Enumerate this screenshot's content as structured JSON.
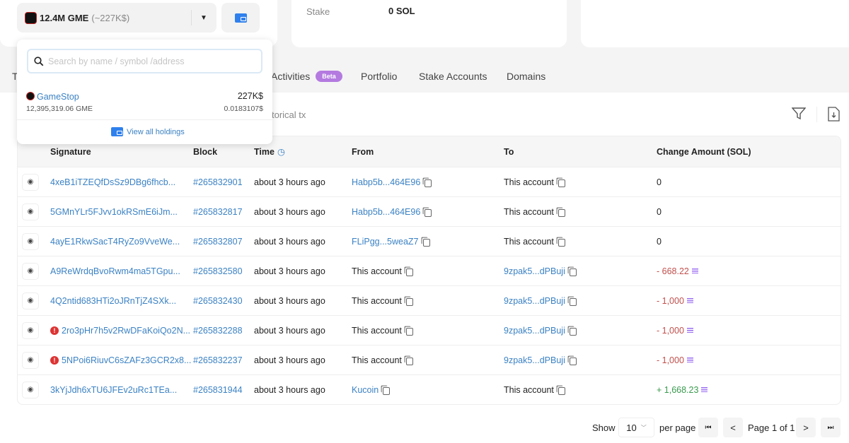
{
  "token_selector": {
    "amount": "12.4M GME",
    "value": "(~227K$)"
  },
  "stake": {
    "label": "Stake",
    "value": "0 SOL"
  },
  "tabs": [
    {
      "label": "T"
    },
    {
      "label": "Activities",
      "badge": "Beta"
    },
    {
      "label": "Portfolio"
    },
    {
      "label": "Stake Accounts"
    },
    {
      "label": "Domains"
    }
  ],
  "historical_text": "torical tx",
  "dropdown": {
    "search_placeholder": "Search by name / symbol /address",
    "holding": {
      "name": "GameStop",
      "amount": "12,395,319.06 GME",
      "value": "227K$",
      "price": "0.0183107$"
    },
    "view_all": "View all holdings"
  },
  "table": {
    "headers": [
      "Signature",
      "Block",
      "Time",
      "From",
      "To",
      "Change Amount (SOL)"
    ],
    "rows": [
      {
        "sig": "4xeB1iTZEQfDsSz9DBg6fhcb...",
        "err": false,
        "block": "#265832901",
        "time": "about 3 hours ago",
        "from": "Habp5b...464E96",
        "from_link": true,
        "to": "This account",
        "to_link": false,
        "change": "0",
        "dir": "zero"
      },
      {
        "sig": "5GMnYLr5FJvv1okRSmE6iJm...",
        "err": false,
        "block": "#265832817",
        "time": "about 3 hours ago",
        "from": "Habp5b...464E96",
        "from_link": true,
        "to": "This account",
        "to_link": false,
        "change": "0",
        "dir": "zero"
      },
      {
        "sig": "4ayE1RkwSacT4RyZo9VveWe...",
        "err": false,
        "block": "#265832807",
        "time": "about 3 hours ago",
        "from": "FLiPgg...5weaZ7",
        "from_link": true,
        "to": "This account",
        "to_link": false,
        "change": "0",
        "dir": "zero"
      },
      {
        "sig": "A9ReWrdqBvoRwm4ma5TGpu...",
        "err": false,
        "block": "#265832580",
        "time": "about 3 hours ago",
        "from": "This account",
        "from_link": false,
        "to": "9zpak5...dPBuji",
        "to_link": true,
        "change": "- 668.22",
        "dir": "neg"
      },
      {
        "sig": "4Q2ntid683HTi2oJRnTjZ4SXk...",
        "err": false,
        "block": "#265832430",
        "time": "about 3 hours ago",
        "from": "This account",
        "from_link": false,
        "to": "9zpak5...dPBuji",
        "to_link": true,
        "change": "- 1,000",
        "dir": "neg"
      },
      {
        "sig": "2ro3pHr7h5v2RwDFaKoiQo2N...",
        "err": true,
        "block": "#265832288",
        "time": "about 3 hours ago",
        "from": "This account",
        "from_link": false,
        "to": "9zpak5...dPBuji",
        "to_link": true,
        "change": "- 1,000",
        "dir": "neg"
      },
      {
        "sig": "5NPoi6RiuvC6sZAFz3GCR2x8...",
        "err": true,
        "block": "#265832237",
        "time": "about 3 hours ago",
        "from": "This account",
        "from_link": false,
        "to": "9zpak5...dPBuji",
        "to_link": true,
        "change": "- 1,000",
        "dir": "neg"
      },
      {
        "sig": "3kYjJdh6xTU6JFEv2uRc1TEa...",
        "err": false,
        "block": "#265831944",
        "time": "about 3 hours ago",
        "from": "Kucoin",
        "from_link": true,
        "to": "This account",
        "to_link": false,
        "change": "+ 1,668.23",
        "dir": "pos"
      }
    ]
  },
  "pagination": {
    "show": "Show",
    "per_page_value": "10",
    "per_page": "per page",
    "page_text": "Page 1 of 1"
  },
  "colors": {
    "link": "#3b82c4",
    "negative": "#c0504d",
    "positive": "#3a9a4e",
    "beta": "#b47ae0",
    "error": "#d33333"
  }
}
